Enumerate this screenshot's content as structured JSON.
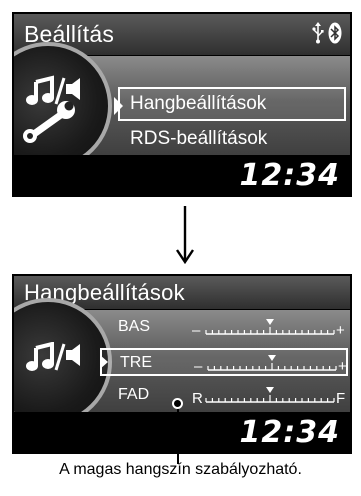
{
  "screen1": {
    "title": "Beállítás",
    "status_icons": [
      "usb-icon",
      "bluetooth-icon"
    ],
    "menu": [
      {
        "label": "Hangbeállítások",
        "selected": true
      },
      {
        "label": "RDS-beállítások",
        "selected": false
      }
    ],
    "clock": "12:34"
  },
  "screen2": {
    "title": "Hangbeállítások",
    "rows": [
      {
        "label": "BAS",
        "left_mark": "–",
        "right_mark": "+",
        "level": 0.5,
        "selected": false
      },
      {
        "label": "TRE",
        "left_mark": "–",
        "right_mark": "+",
        "level": 0.5,
        "selected": true
      },
      {
        "label": "FAD",
        "left_mark": "R",
        "right_mark": "F",
        "level": 0.5,
        "selected": false
      }
    ],
    "clock": "12:34"
  },
  "caption": "A magas hangszín szabályozható."
}
